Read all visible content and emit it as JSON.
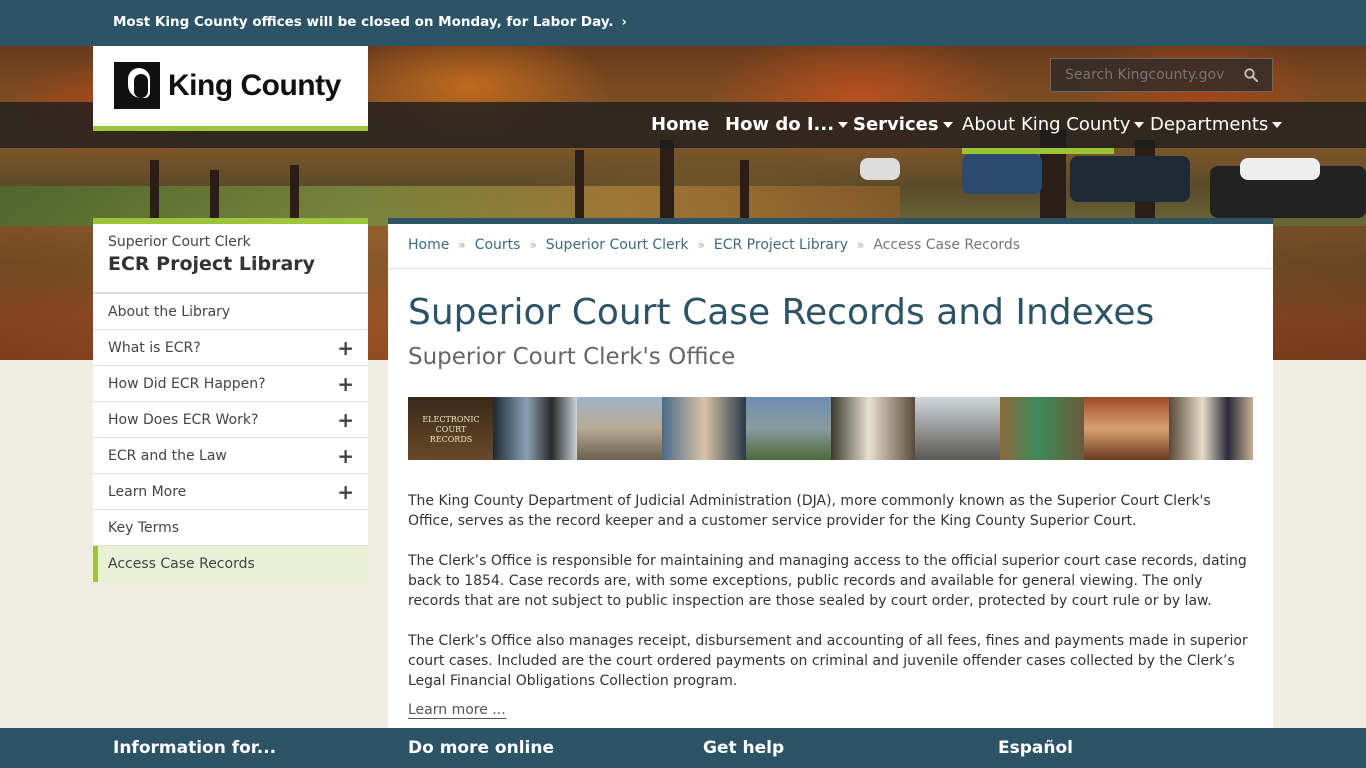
{
  "alert": {
    "text": "Most King County offices will be closed on Monday, for Labor Day.",
    "chevron": "›"
  },
  "logo": {
    "name": "King County"
  },
  "search": {
    "placeholder": "Search Kingcounty.gov"
  },
  "main_nav": [
    {
      "label": "Home"
    },
    {
      "label": "How do I..."
    },
    {
      "label": "Services"
    },
    {
      "label": "About King County"
    },
    {
      "label": "Departments"
    }
  ],
  "sidebar": {
    "parent": "Superior Court Clerk",
    "title": "ECR Project Library",
    "items": [
      {
        "label": "About the Library",
        "expandable": false
      },
      {
        "label": "What is ECR?",
        "expandable": true
      },
      {
        "label": "How Did ECR Happen?",
        "expandable": true
      },
      {
        "label": "How Does ECR Work?",
        "expandable": true
      },
      {
        "label": "ECR and the Law",
        "expandable": true
      },
      {
        "label": "Learn More",
        "expandable": true
      },
      {
        "label": "Key Terms",
        "expandable": false
      },
      {
        "label": "Access Case Records",
        "expandable": false,
        "active": true
      }
    ]
  },
  "breadcrumb": [
    "Home",
    "Courts",
    "Superior Court Clerk",
    "ECR Project Library",
    "Access Case Records"
  ],
  "page": {
    "title": "Superior Court Case Records and Indexes",
    "subtitle": "Superior Court Clerk's Office",
    "banner_text": "ELECTRONIC COURT RECORDS",
    "paragraphs": [
      "The King County Department of Judicial Administration (DJA), more commonly known as the Superior Court Clerk's Office, serves as the record keeper and a customer service provider for the King County Superior Court.",
      "The Clerk’s Office is responsible for maintaining and managing access to the official superior court case records, dating back to 1854. Case records are, with some exceptions, public records and available for general viewing. The only records that are not subject to public inspection are those sealed by court order, protected by court rule or by law.",
      "The Clerk’s Office also manages receipt, disbursement and accounting of all fees, fines and payments made in superior court cases. Included are the court ordered payments on criminal and juvenile offender cases collected by the Clerk’s Legal Financial Obligations Collection program."
    ],
    "learn_more": "Learn more ..."
  },
  "footer": [
    "Information for...",
    "Do more online",
    "Get help",
    "Español"
  ],
  "colors": {
    "brand_blue": "#2c5366",
    "accent_green": "#9bc43a",
    "link_blue": "#3d6a82",
    "page_bg": "#efece0"
  }
}
